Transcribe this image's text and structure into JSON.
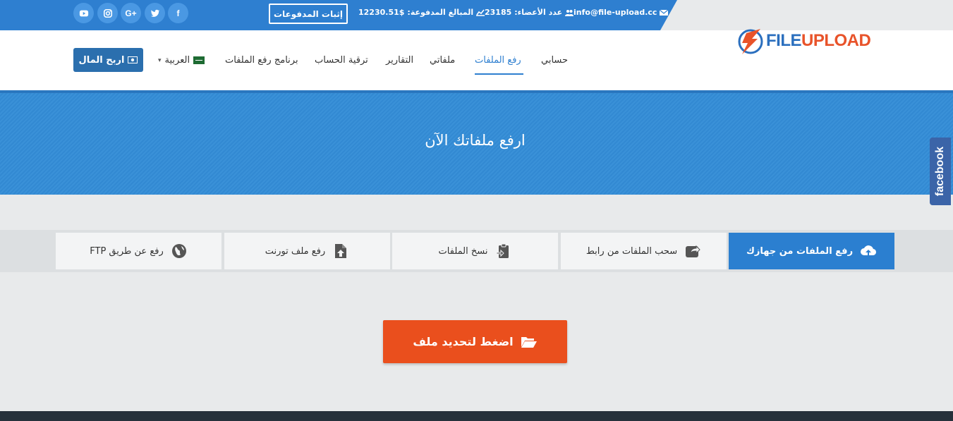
{
  "topbar": {
    "email": "info@file-upload.cc",
    "members_label": "عدد الأعضاء:",
    "members_count": "23185",
    "paid_label": "المبالغ المدفوعة:",
    "paid_amount": "12230.51$",
    "proof_button": "إثبات المدفوعات",
    "social": [
      {
        "name": "youtube",
        "glyph": "▶"
      },
      {
        "name": "instagram",
        "glyph": "◎"
      },
      {
        "name": "google-plus",
        "glyph": "G+"
      },
      {
        "name": "twitter",
        "glyph": "t"
      },
      {
        "name": "facebook",
        "glyph": "f"
      }
    ]
  },
  "header": {
    "logo_part1": "FILE",
    "logo_part2": "UPLOAD",
    "earn_button": "اربح المال",
    "nav": {
      "account": "حسابي",
      "upload": "رفع الملفات",
      "my_files": "ملفاتي",
      "reports": "التقارير",
      "upgrade": "ترقية الحساب",
      "uploader_app": "برنامج رفع الملفات",
      "language": "العربية"
    }
  },
  "hero": {
    "title": "ارفع ملفاتك الآن"
  },
  "facebook_tab": "facebook",
  "tabs": {
    "from_device": "رفع الملفات من جهازك",
    "from_link": "سحب الملفات من رابط",
    "copy_files": "نسخ الملفات",
    "torrent": "رفع ملف تورنت",
    "ftp": "رفع عن طريق FTP"
  },
  "select_button": "اضغط لتحديد ملف",
  "colors": {
    "primary": "#2e7fd0",
    "accent": "#ea4f1d",
    "facebook": "#3b64a8"
  }
}
